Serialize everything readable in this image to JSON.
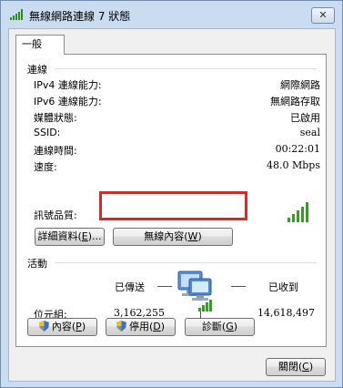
{
  "window": {
    "title": "無線網路連線 7 狀態",
    "close_label": "✕"
  },
  "tab": {
    "label": "一般"
  },
  "connection": {
    "heading": "連線",
    "rows": [
      {
        "label": "IPv4 連線能力:",
        "value": "網際網路"
      },
      {
        "label": "IPv6 連線能力:",
        "value": "無網路存取"
      },
      {
        "label": "媒體狀態:",
        "value": "已啟用"
      },
      {
        "label": "SSID:",
        "value": "seal"
      },
      {
        "label": "連線時間:",
        "value": "00:22:01"
      },
      {
        "label": "速度:",
        "value": "48.0 Mbps"
      }
    ],
    "signal_label": "訊號品質:",
    "signal_level": "5/5",
    "details_button": {
      "text": "詳細資料(",
      "key": "E",
      "suffix": ")..."
    },
    "wireless_props_button": {
      "text": "無線內容(",
      "key": "W",
      "suffix": ")"
    }
  },
  "activity": {
    "heading": "活動",
    "sent_label": "已傳送",
    "received_label": "已收到",
    "bytes_label": "位元組:",
    "bytes_sent": "3,162,255",
    "bytes_received": "14,618,497"
  },
  "buttons": {
    "properties": {
      "text": "內容(",
      "key": "P",
      "suffix": ")"
    },
    "disable": {
      "text": "停用(",
      "key": "D",
      "suffix": ")"
    },
    "diagnose": {
      "text": "診斷(",
      "key": "G",
      "suffix": ")"
    },
    "close": {
      "text": "關閉(",
      "key": "C",
      "suffix": ")"
    }
  },
  "colors": {
    "highlight": "#e0252e",
    "signal": "#3a9b2a"
  }
}
